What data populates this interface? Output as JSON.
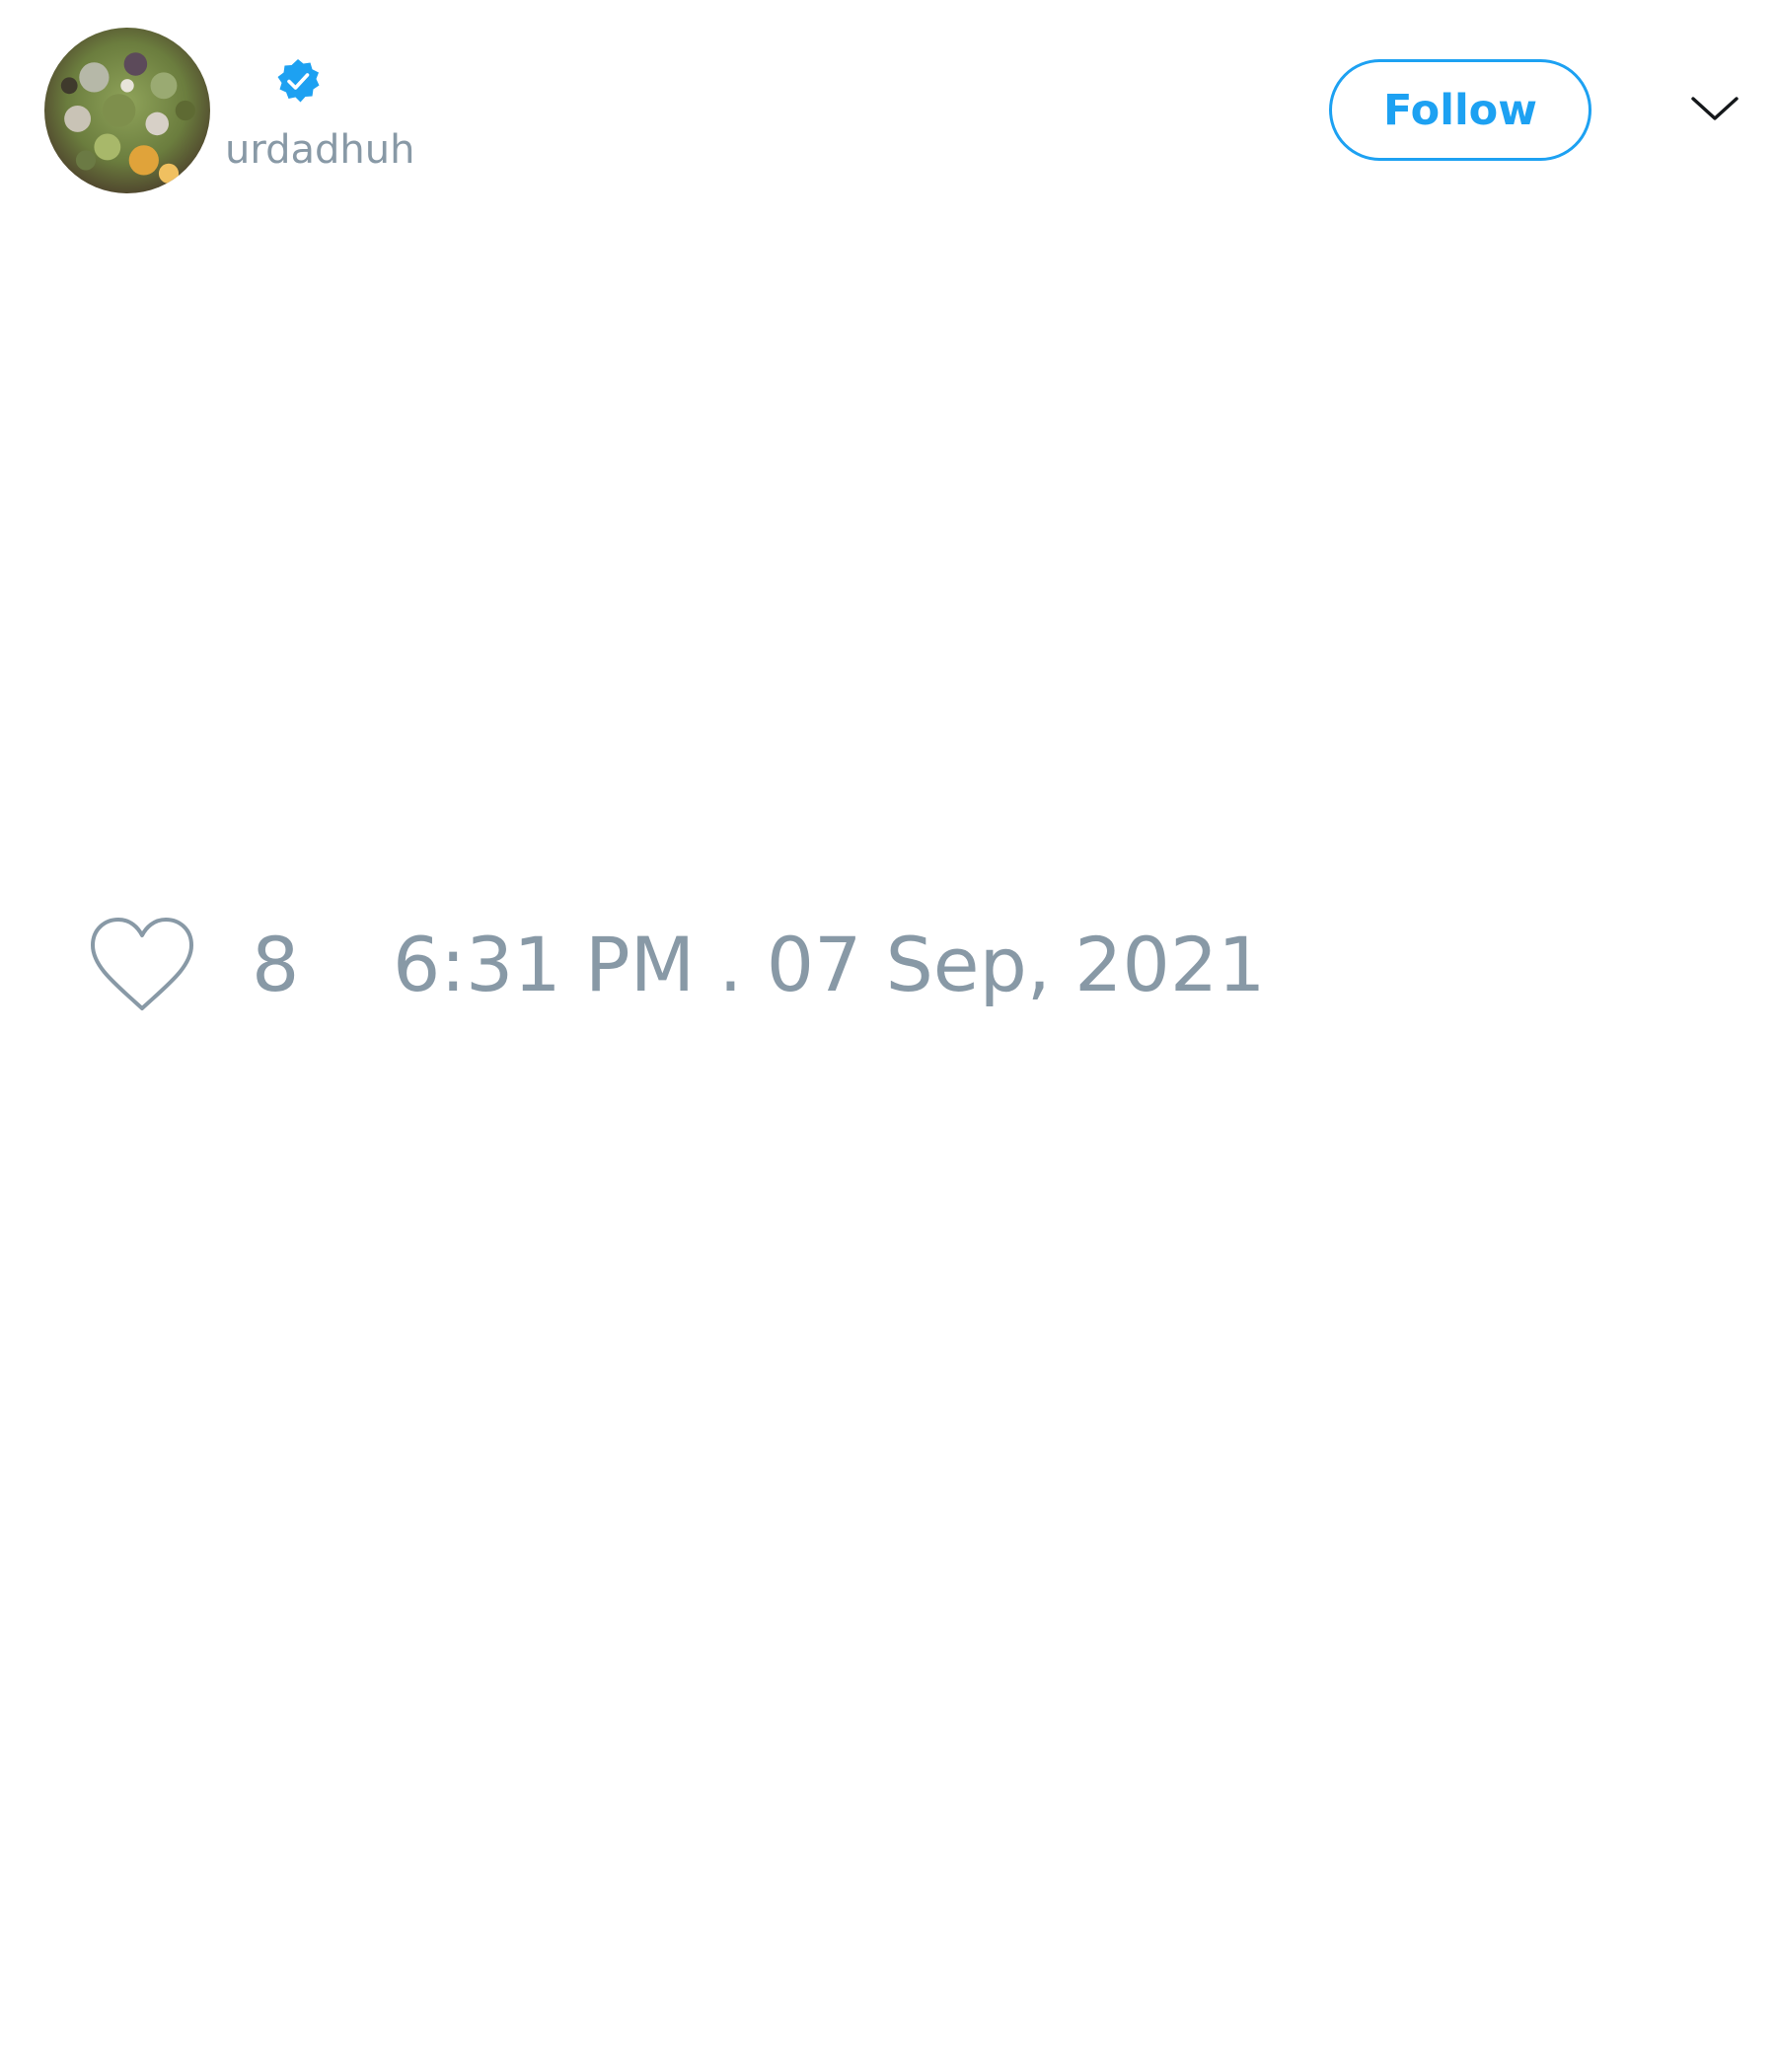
{
  "tweet": {
    "author": {
      "handle": "urdadhuh",
      "verified": true,
      "avatar_description": "photo of green foliage with small flowers"
    },
    "follow_button_label": "Follow",
    "likes": "8",
    "timestamp": "6:31 PM . 07 Sep, 2021"
  },
  "icons": {
    "verified": "verified-badge-icon",
    "menu": "chevron-down-icon",
    "like": "heart-outline-icon"
  },
  "colors": {
    "accent": "#1da1f2",
    "muted_text": "#8899a6",
    "icon_dark": "#14171a",
    "background": "#ffffff"
  }
}
